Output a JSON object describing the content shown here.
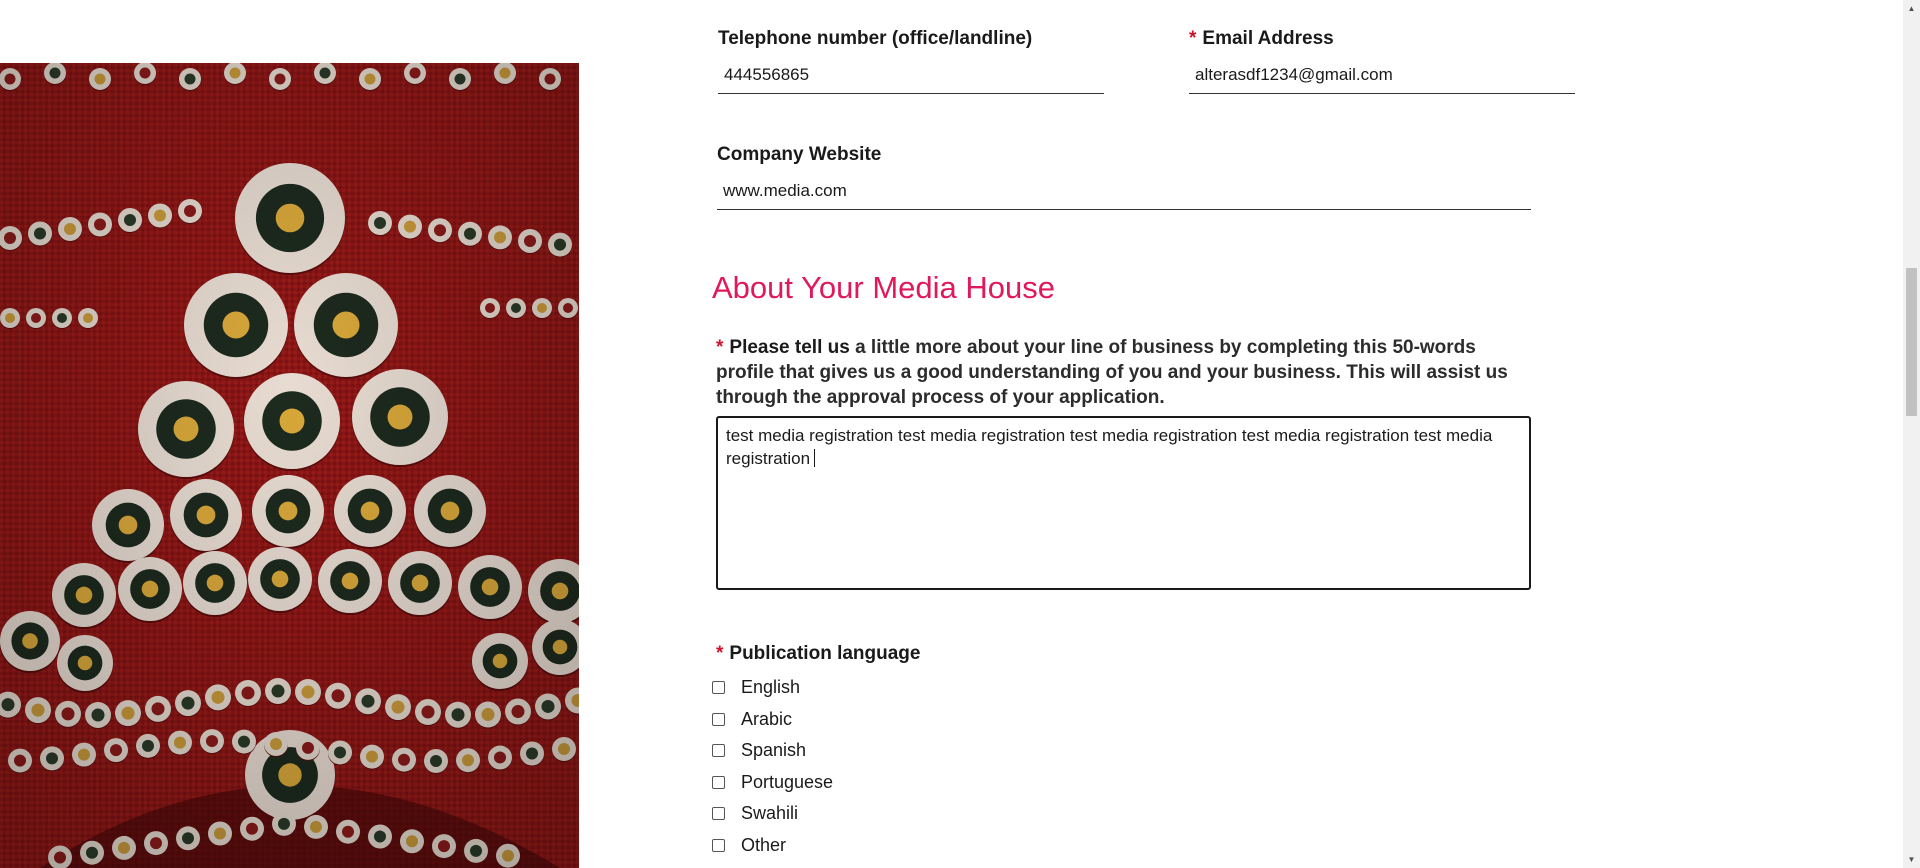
{
  "contact": {
    "telephone_label": "Telephone number (office/landline)",
    "telephone_value": "444556865",
    "email_label": "Email Address",
    "email_value": "alterasdf1234@gmail.com",
    "website_label": "Company Website",
    "website_value": "www.media.com",
    "required_mark": "*"
  },
  "about": {
    "section_title": "About Your Media House",
    "profile_label_bold": "Please tell us",
    "profile_label_rest": " a little more about your line of business by completing this 50-words profile that gives us a good understanding of you and your business. This will assist us through the approval process of your application.",
    "profile_value": "test media registration test media registration test media registration test media registration test media registration"
  },
  "languages": {
    "label": "Publication language",
    "options": [
      {
        "label": "English",
        "checked": false
      },
      {
        "label": "Arabic",
        "checked": false
      },
      {
        "label": "Spanish",
        "checked": false
      },
      {
        "label": "Portuguese",
        "checked": false
      },
      {
        "label": "Swahili",
        "checked": false
      },
      {
        "label": "Other",
        "checked": false
      }
    ]
  },
  "colors": {
    "accent": "#e0195a",
    "required": "#d0112b",
    "image_base": "#8a1414"
  },
  "icons": {
    "scroll_up": "triangle-up-icon",
    "scroll_down": "triangle-down-icon"
  }
}
